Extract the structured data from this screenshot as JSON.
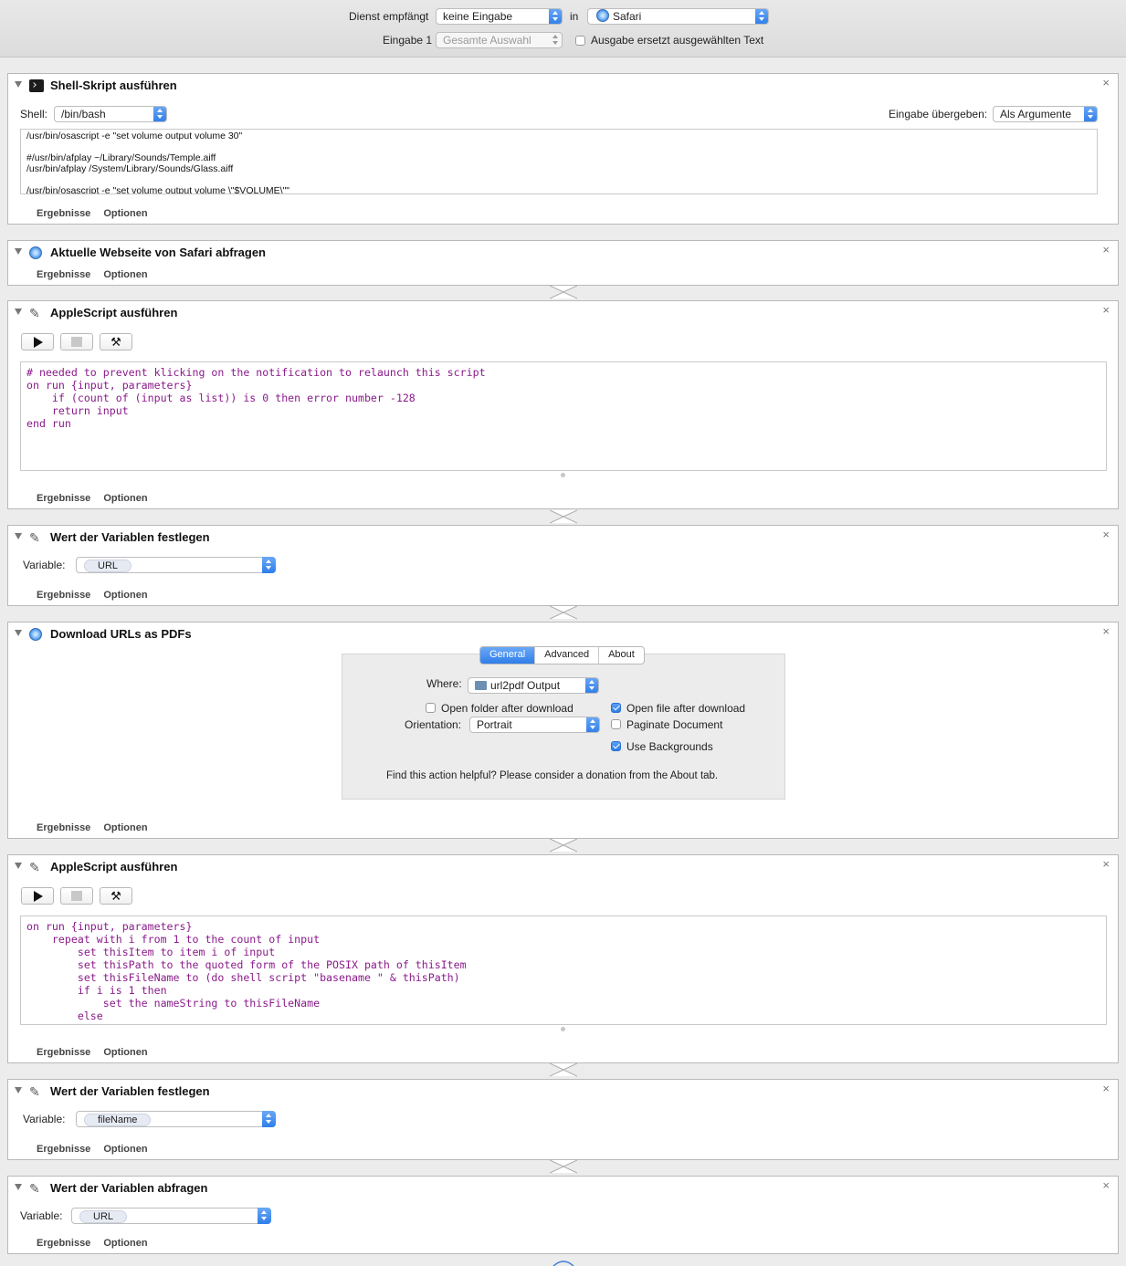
{
  "header": {
    "service_receives_label": "Dienst empfängt",
    "service_receives_value": "keine Eingabe",
    "in_label": "in",
    "app_value": "Safari",
    "input_label": "Eingabe 1",
    "input_value": "Gesamte Auswahl",
    "replace_checkbox_label": "Ausgabe ersetzt ausgewählten Text"
  },
  "actions": [
    {
      "title": "Shell-Skript ausführen",
      "shell_label": "Shell:",
      "shell_value": "/bin/bash",
      "pass_input_label": "Eingabe übergeben:",
      "pass_input_value": "Als Argumente",
      "code": "/usr/bin/osascript -e \"set volume output volume 30\"\n\n#/usr/bin/afplay ~/Library/Sounds/Temple.aiff\n/usr/bin/afplay /System/Library/Sounds/Glass.aiff\n\n/usr/bin/osascript -e \"set volume output volume \\\"$VOLUME\\\"\"",
      "results_label": "Ergebnisse",
      "options_label": "Optionen"
    },
    {
      "title": "Aktuelle Webseite von Safari abfragen",
      "results_label": "Ergebnisse",
      "options_label": "Optionen"
    },
    {
      "title": "AppleScript ausführen",
      "code": "# needed to prevent klicking on the notification to relaunch this script\non run {input, parameters}\n    if (count of (input as list)) is 0 then error number -128\n    return input\nend run",
      "results_label": "Ergebnisse",
      "options_label": "Optionen"
    },
    {
      "title": "Wert der Variablen festlegen",
      "variable_label": "Variable:",
      "variable_value": "URL",
      "results_label": "Ergebnisse",
      "options_label": "Optionen"
    },
    {
      "title": "Download URLs as PDFs",
      "tabs": [
        "General",
        "Advanced",
        "About"
      ],
      "where_label": "Where:",
      "where_value": "url2pdf Output",
      "open_folder_label": "Open folder after download",
      "open_file_label": "Open file after download",
      "orientation_label": "Orientation:",
      "orientation_value": "Portrait",
      "paginate_label": "Paginate Document",
      "backgrounds_label": "Use Backgrounds",
      "donation_text": "Find this action helpful? Please consider a donation from the About tab.",
      "results_label": "Ergebnisse",
      "options_label": "Optionen"
    },
    {
      "title": "AppleScript ausführen",
      "code": "on run {input, parameters}\n    repeat with i from 1 to the count of input\n        set thisItem to item i of input\n        set thisPath to the quoted form of the POSIX path of thisItem\n        set thisFileName to (do shell script \"basename \" & thisPath)\n        if i is 1 then\n            set the nameString to thisFileName\n        else",
      "results_label": "Ergebnisse",
      "options_label": "Optionen"
    },
    {
      "title": "Wert der Variablen festlegen",
      "variable_label": "Variable:",
      "variable_value": "fileName",
      "results_label": "Ergebnisse",
      "options_label": "Optionen"
    },
    {
      "title": "Wert der Variablen abfragen",
      "variable_label": "Variable:",
      "variable_value": "URL",
      "results_label": "Ergebnisse",
      "options_label": "Optionen"
    }
  ],
  "close_glyph": "×"
}
